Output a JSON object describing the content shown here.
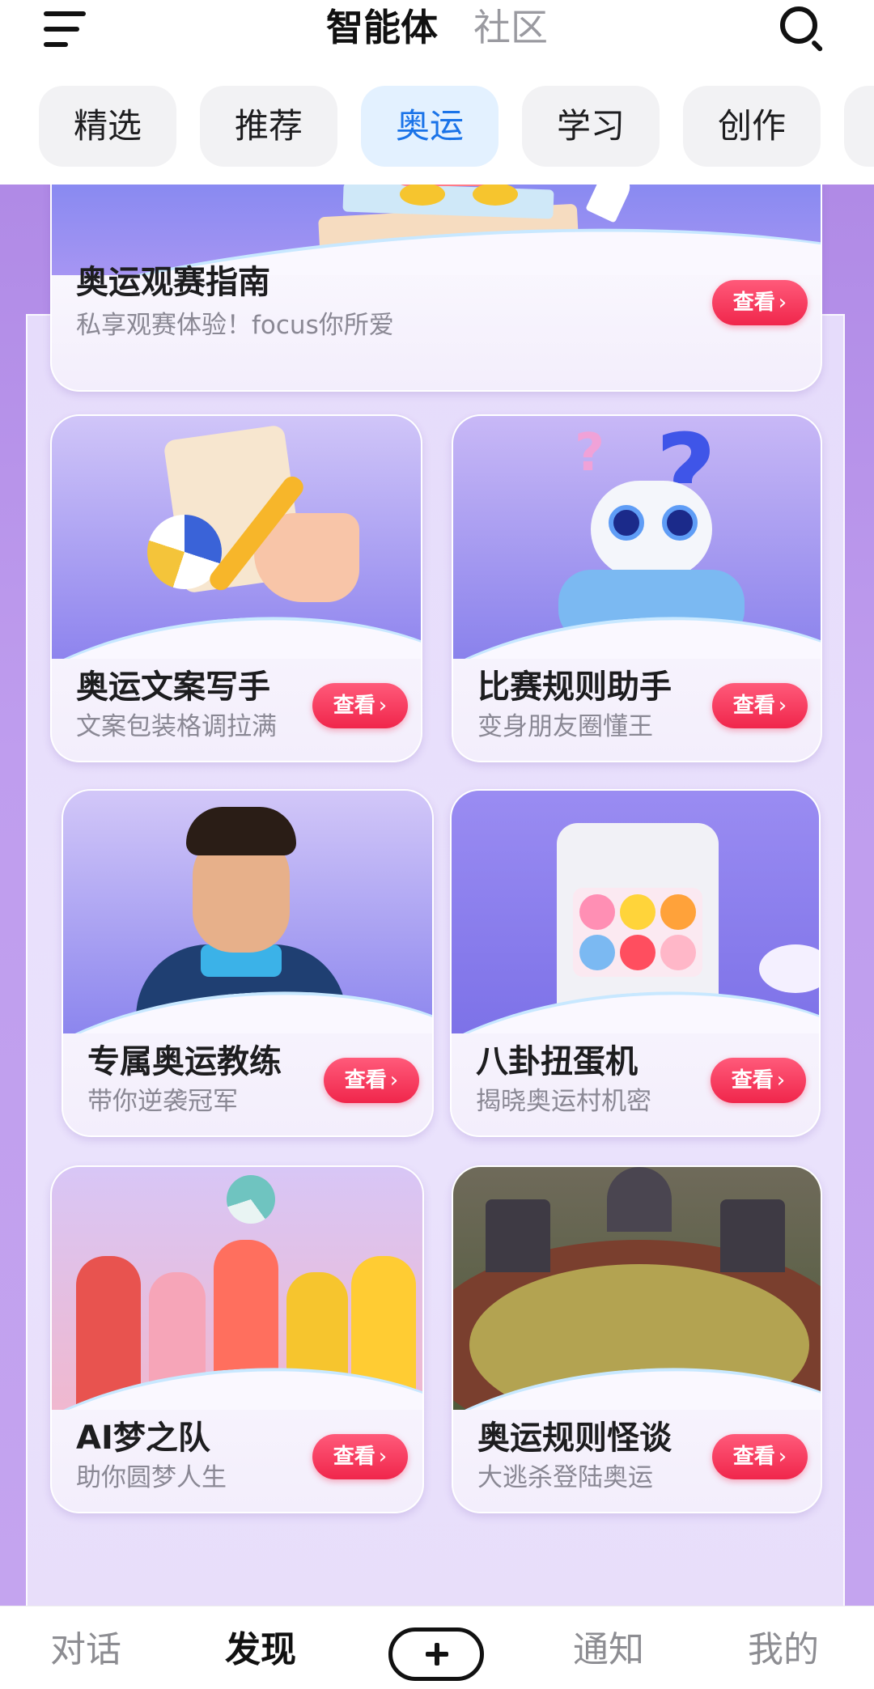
{
  "header": {
    "tabs": [
      {
        "label": "智能体",
        "active": true
      },
      {
        "label": "社区",
        "active": false
      }
    ],
    "menu_icon": "hamburger-menu-icon",
    "search_icon": "search-icon"
  },
  "categories": [
    {
      "label": "精选",
      "active": false
    },
    {
      "label": "推荐",
      "active": false
    },
    {
      "label": "奥运",
      "active": true
    },
    {
      "label": "学习",
      "active": false
    },
    {
      "label": "创作",
      "active": false
    }
  ],
  "cards": [
    {
      "title": "奥运观赛指南",
      "subtitle": "私享观赛体验！focus你所爱",
      "button": "查看",
      "illustration": "mascot-on-books-badminton"
    },
    {
      "title": "奥运文案写手",
      "subtitle": "文案包装格调拉满",
      "button": "查看",
      "illustration": "volleyball-scroll-pen"
    },
    {
      "title": "比赛规则助手",
      "subtitle": "变身朋友圈懂王",
      "button": "查看",
      "illustration": "robot-question-marks"
    },
    {
      "title": "专属奥运教练",
      "subtitle": "带你逆袭冠军",
      "button": "查看",
      "illustration": "coach-character"
    },
    {
      "title": "八卦扭蛋机",
      "subtitle": "揭晓奥运村机密",
      "button": "查看",
      "illustration": "gacha-machine"
    },
    {
      "title": "AI梦之队",
      "subtitle": "助你圆梦人生",
      "button": "查看",
      "illustration": "athlete-team"
    },
    {
      "title": "奥运规则怪谈",
      "subtitle": "大逃杀登陆奥运",
      "button": "查看",
      "illustration": "stadium-aerial"
    }
  ],
  "bottom_nav": [
    {
      "label": "对话",
      "active": false
    },
    {
      "label": "发现",
      "active": true
    },
    {
      "label": "",
      "icon": "plus-icon"
    },
    {
      "label": "通知",
      "active": false
    },
    {
      "label": "我的",
      "active": false
    }
  ],
  "colors": {
    "accent_blue": "#1a73e8",
    "view_button": "#f0264b",
    "background_purple": "#b08ae6"
  }
}
